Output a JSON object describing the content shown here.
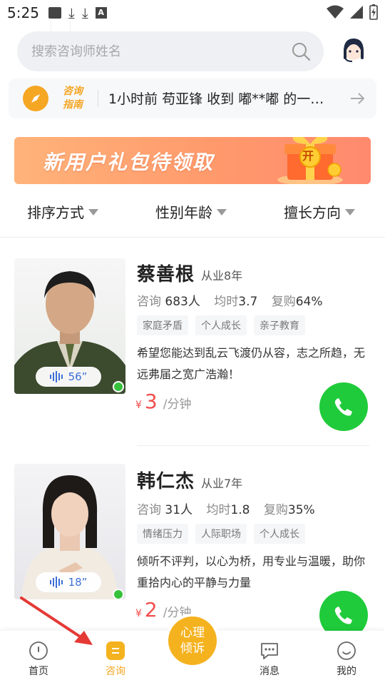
{
  "status_bar": {
    "time": "5:25"
  },
  "search": {
    "placeholder": "搜索咨询师姓名"
  },
  "notice": {
    "tag_line1": "咨询",
    "tag_line2": "指南",
    "text": "1小时前 苟亚锋 收到 嘟**嘟 的一…"
  },
  "banner": {
    "text": "新用户礼包待领取",
    "gift_label": "开"
  },
  "filters": [
    {
      "label": "排序方式"
    },
    {
      "label": "性别年龄"
    },
    {
      "label": "擅长方向"
    }
  ],
  "counselors": [
    {
      "name": "蔡善根",
      "years": "从业8年",
      "consult_label": "咨询",
      "consult_value": "683人",
      "avg_label": "均时",
      "avg_value": "3.7",
      "repurchase_label": "复购",
      "repurchase_value": "64%",
      "tags": [
        "家庭矛盾",
        "个人成长",
        "亲子教育"
      ],
      "bio": "希望您能达到乱云飞渡仍从容，志之所趋，无远弗届之宽广浩瀚！",
      "voice_duration": "56”",
      "price_currency": "¥",
      "price": "3",
      "price_unit": "/分钟",
      "online": true
    },
    {
      "name": "韩仁杰",
      "years": "从业7年",
      "consult_label": "咨询",
      "consult_value": "31人",
      "avg_label": "均时",
      "avg_value": "1.8",
      "repurchase_label": "复购",
      "repurchase_value": "35%",
      "tags": [
        "情绪压力",
        "人际职场",
        "个人成长"
      ],
      "bio": "倾听不评判，以心为桥，用专业与温暖，助你重拾内心的平静与力量",
      "voice_duration": "18”",
      "price_currency": "¥",
      "price": "2",
      "price_unit": "/分钟",
      "online": true
    }
  ],
  "bottom_nav": {
    "items": [
      {
        "label": "首页",
        "icon": "home-icon"
      },
      {
        "label": "咨询",
        "icon": "consult-icon",
        "active": true
      },
      {
        "label": "消息",
        "icon": "message-icon"
      },
      {
        "label": "我的",
        "icon": "profile-icon"
      }
    ],
    "center": {
      "line1": "心理",
      "line2": "倾诉"
    }
  },
  "colors": {
    "accent": "#f5a623",
    "price": "#f24d4d",
    "call": "#1fcb3a",
    "voice": "#3b6fd8",
    "online": "#36c23b"
  }
}
